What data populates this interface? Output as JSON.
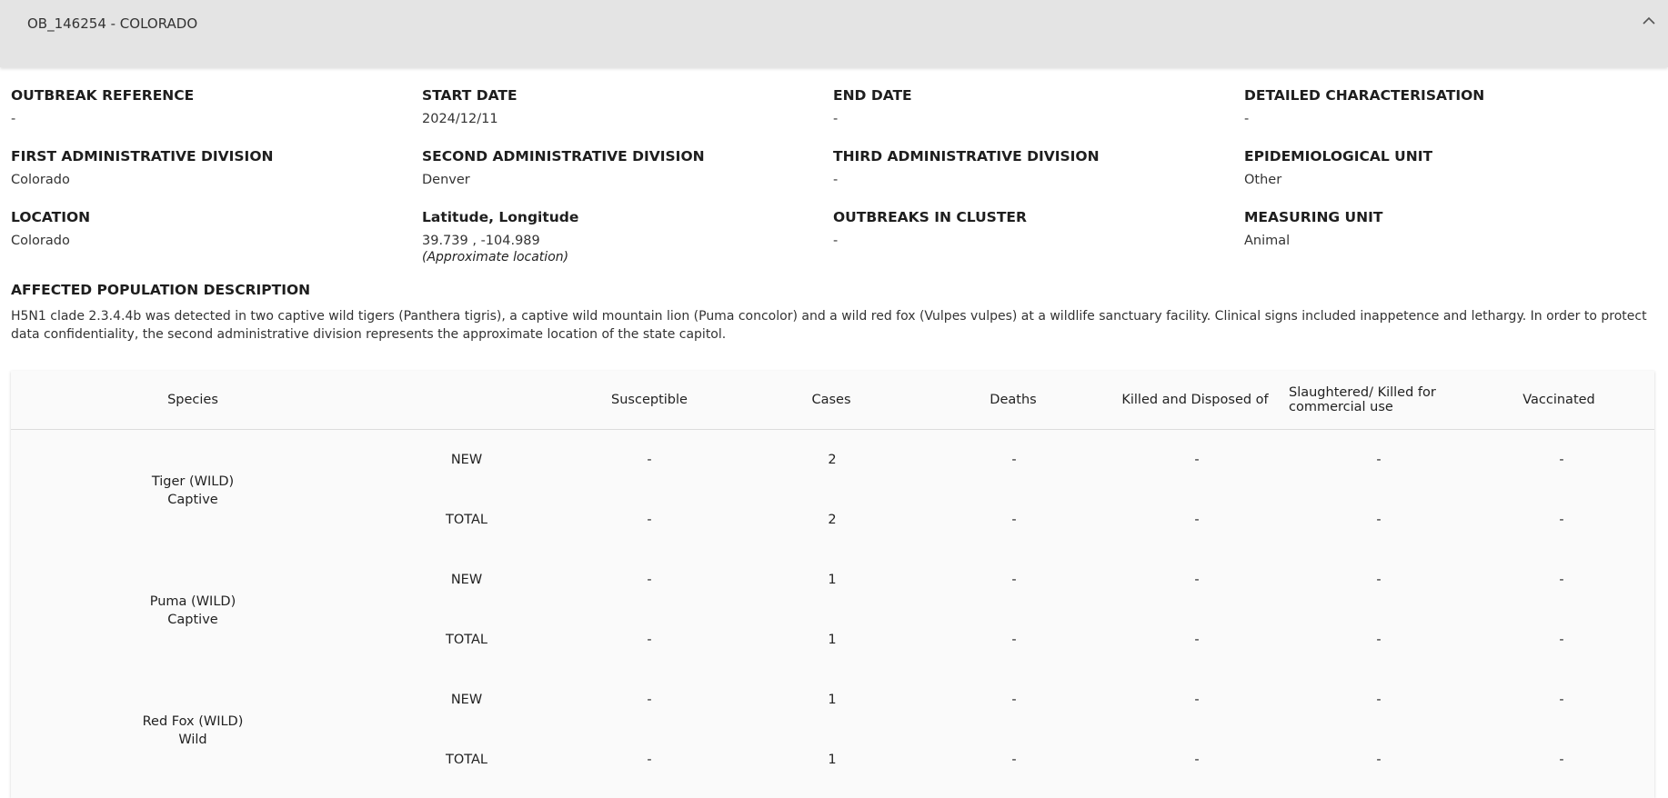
{
  "header": {
    "title": "OB_146254 - COLORADO"
  },
  "fields": [
    {
      "label": "OUTBREAK REFERENCE",
      "value": "-"
    },
    {
      "label": "START DATE",
      "value": "2024/12/11"
    },
    {
      "label": "END DATE",
      "value": "-"
    },
    {
      "label": "DETAILED CHARACTERISATION",
      "value": "-"
    },
    {
      "label": "FIRST ADMINISTRATIVE DIVISION",
      "value": "Colorado"
    },
    {
      "label": "SECOND ADMINISTRATIVE DIVISION",
      "value": "Denver"
    },
    {
      "label": "THIRD ADMINISTRATIVE DIVISION",
      "value": "-"
    },
    {
      "label": "EPIDEMIOLOGICAL UNIT",
      "value": "Other"
    },
    {
      "label": "LOCATION",
      "value": "Colorado"
    },
    {
      "label": "Latitude, Longitude",
      "value": "39.739 , -104.989",
      "note": "(Approximate location)"
    },
    {
      "label": "OUTBREAKS IN CLUSTER",
      "value": "-"
    },
    {
      "label": "MEASURING UNIT",
      "value": "Animal"
    }
  ],
  "description": {
    "label": "AFFECTED POPULATION DESCRIPTION",
    "text": "H5N1 clade 2.3.4.4b was detected in two captive wild tigers (Panthera tigris), a captive wild mountain lion (Puma concolor) and a wild red fox (Vulpes vulpes) at a wildlife sanctuary facility. Clinical signs included inappetence and lethargy. In order to protect data confidentiality, the second administrative division represents the approximate location of the state capitol."
  },
  "table": {
    "headers": {
      "species": "Species",
      "susceptible": "Susceptible",
      "cases": "Cases",
      "deaths": "Deaths",
      "killed": "Killed and Disposed of",
      "slaughtered": "Slaughtered/ Killed for commercial use",
      "vaccinated": "Vaccinated"
    },
    "groups": [
      {
        "name": "Tiger (WILD)",
        "sub": "Captive",
        "rows": [
          {
            "kind": "NEW",
            "susceptible": "-",
            "cases": "2",
            "deaths": "-",
            "killed": "-",
            "slaughtered": "-",
            "vaccinated": "-"
          },
          {
            "kind": "TOTAL",
            "susceptible": "-",
            "cases": "2",
            "deaths": "-",
            "killed": "-",
            "slaughtered": "-",
            "vaccinated": "-"
          }
        ]
      },
      {
        "name": "Puma (WILD)",
        "sub": "Captive",
        "rows": [
          {
            "kind": "NEW",
            "susceptible": "-",
            "cases": "1",
            "deaths": "-",
            "killed": "-",
            "slaughtered": "-",
            "vaccinated": "-"
          },
          {
            "kind": "TOTAL",
            "susceptible": "-",
            "cases": "1",
            "deaths": "-",
            "killed": "-",
            "slaughtered": "-",
            "vaccinated": "-"
          }
        ]
      },
      {
        "name": "Red Fox (WILD)",
        "sub": "Wild",
        "rows": [
          {
            "kind": "NEW",
            "susceptible": "-",
            "cases": "1",
            "deaths": "-",
            "killed": "-",
            "slaughtered": "-",
            "vaccinated": "-"
          },
          {
            "kind": "TOTAL",
            "susceptible": "-",
            "cases": "1",
            "deaths": "-",
            "killed": "-",
            "slaughtered": "-",
            "vaccinated": "-"
          }
        ]
      }
    ]
  },
  "icons": {
    "collapse": "chevron-up-icon"
  }
}
